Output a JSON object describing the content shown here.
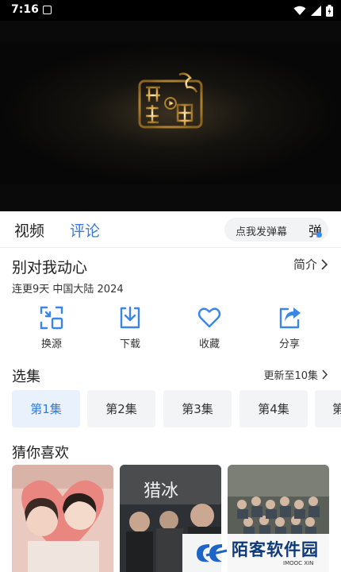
{
  "status_bar": {
    "time": "7:16"
  },
  "tabs": {
    "video_label": "视频",
    "comment_label": "评论"
  },
  "danmu": {
    "placeholder": "点我发弹幕",
    "icon_label": "弹"
  },
  "show": {
    "title": "别对我动心",
    "meta": "连更9天 中国大陆 2024",
    "intro_label": "简介"
  },
  "actions": [
    {
      "label": "换源",
      "icon": "switch-source-icon"
    },
    {
      "label": "下载",
      "icon": "download-icon"
    },
    {
      "label": "收藏",
      "icon": "heart-icon"
    },
    {
      "label": "分享",
      "icon": "share-icon"
    }
  ],
  "episodes": {
    "heading": "选集",
    "update_label": "更新至10集",
    "items": [
      "第1集",
      "第2集",
      "第3集",
      "第4集",
      "第"
    ],
    "selected_index": 0
  },
  "recommend": {
    "heading": "猜你喜欢"
  },
  "watermark": {
    "brand": "陌客软件园",
    "sub": "IMOOC XIN"
  },
  "colors": {
    "accent": "#2f7de1",
    "icon_blue": "#3a86e8",
    "selected_bg": "#e9f1fd"
  }
}
